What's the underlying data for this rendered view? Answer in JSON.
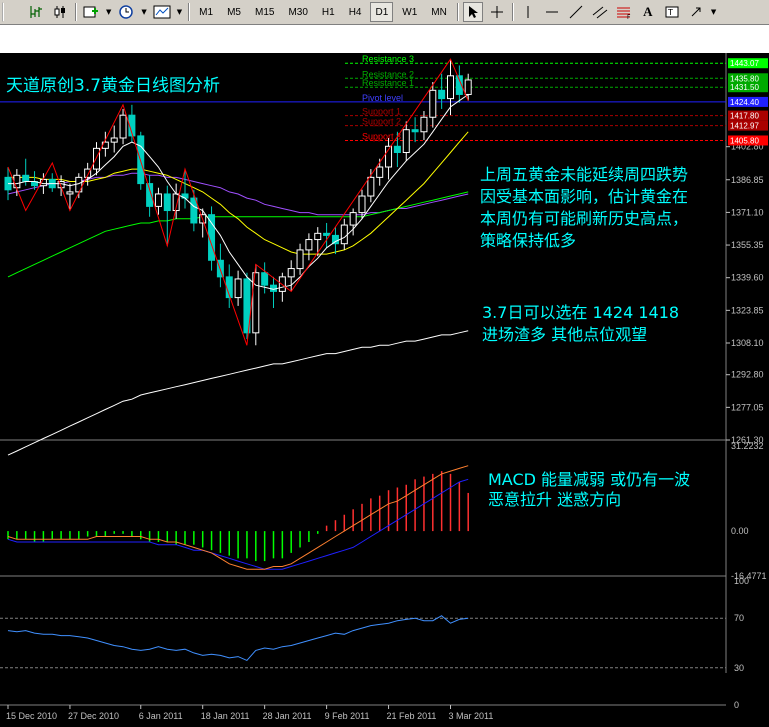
{
  "toolbar": {
    "timeframes": [
      "M1",
      "M5",
      "M15",
      "M30",
      "H1",
      "H4",
      "D1",
      "W1",
      "MN"
    ],
    "active_timeframe": "D1",
    "icons": [
      "chart-bar-icon",
      "chart-candle-icon",
      "chart-line-icon",
      "new-indicator-icon",
      "periods-clock-icon",
      "templates-icon",
      "cursor-icon",
      "crosshair-icon",
      "vertical-line-icon",
      "horizontal-line-icon",
      "trendline-icon",
      "channel-icon",
      "fibo-icon",
      "text-icon",
      "label-icon"
    ]
  },
  "colors": {
    "background": "#000000",
    "bull": "#ffffff",
    "bear": "#00d0c0",
    "ma_fast": "#ffffff",
    "ma_mid": "#ffff00",
    "ma_slow": "#00ff00",
    "ma_200": "#ffffff",
    "ma_purple": "#a050ff",
    "zigzag": "#ff0000",
    "annotation": "#00ffff",
    "grid": "#c0c0c0",
    "macd_pos": "#ff3030",
    "macd_neg": "#00ff00",
    "macd_signal": "#ff8030",
    "macd_main": "#2020ff",
    "rsi": "#4090ff",
    "pivot": "#2020ff",
    "pivot_text": "#4040ff",
    "resistance": "#00ff00",
    "support": "#ff0000"
  },
  "main": {
    "title": "天道原创3.7黄金日线图分析",
    "annotation_1": [
      "上周五黄金未能延续周四跌势",
      "因受基本面影响，估计黄金在",
      "本周仍有可能刷新历史高点，",
      "策略保持低多"
    ],
    "annotation_2": [
      "3.7日可以选在 1424  1418",
      "进场渣多 其他点位观望"
    ],
    "price_ticks": [
      "1402.80",
      "1386.85",
      "1371.10",
      "1355.35",
      "1339.60",
      "1323.85",
      "1308.10",
      "1292.80",
      "1277.05",
      "1261.30"
    ],
    "price_tick_values": [
      1402.8,
      1386.85,
      1371.1,
      1355.35,
      1339.6,
      1323.85,
      1308.1,
      1292.8,
      1277.05,
      1261.3
    ],
    "ylim": [
      1261.3,
      1448
    ],
    "levels": [
      {
        "label": "Resistance 3",
        "price": 1443.07,
        "tag": "1443.07",
        "color": "#00ff00"
      },
      {
        "label": "Resistance 2",
        "price": 1435.8,
        "tag": "1435.80",
        "color": "#00aa00"
      },
      {
        "label": "Resistance 1",
        "price": 1431.5,
        "tag": "1431.50",
        "color": "#00aa00"
      },
      {
        "label": "Pivot level",
        "price": 1424.4,
        "tag": "1424.40",
        "color": "#2020ff"
      },
      {
        "label": "Support 1",
        "price": 1417.8,
        "tag": "1417.80",
        "color": "#aa0000"
      },
      {
        "label": "Support 2",
        "price": 1412.97,
        "tag": "1412.97",
        "color": "#aa0000"
      },
      {
        "label": "Support 3",
        "price": 1405.8,
        "tag": "1405.80",
        "color": "#ff0000"
      }
    ]
  },
  "macd": {
    "annotation": [
      "MACD 能量减弱   或仍有一波",
      "恶意拉升   迷惑方向"
    ],
    "ticks": [
      "31.2232",
      "0.00",
      "-16.4771"
    ],
    "tick_values": [
      31.2232,
      0,
      -16.4771
    ],
    "ylim": [
      -16.4771,
      31.2232
    ]
  },
  "rsi": {
    "ticks": [
      "100",
      "70",
      "30",
      "0"
    ],
    "tick_values": [
      100,
      70,
      30,
      0
    ],
    "ylim": [
      0,
      100
    ]
  },
  "time_axis": [
    "15 Dec 2010",
    "27 Dec 2010",
    "6 Jan 2011",
    "18 Jan 2011",
    "28 Jan 2011",
    "9 Feb 2011",
    "21 Feb 2011",
    "3 Mar 2011"
  ],
  "chart_data": {
    "type": "candlestick",
    "title": "天道原创3.7黄金日线图分析",
    "candles": [
      {
        "o": 1388,
        "h": 1393,
        "l": 1377,
        "c": 1382
      },
      {
        "o": 1383,
        "h": 1392,
        "l": 1379,
        "c": 1389
      },
      {
        "o": 1389,
        "h": 1397,
        "l": 1384,
        "c": 1386
      },
      {
        "o": 1386,
        "h": 1391,
        "l": 1382,
        "c": 1384
      },
      {
        "o": 1384,
        "h": 1390,
        "l": 1380,
        "c": 1387
      },
      {
        "o": 1387,
        "h": 1390,
        "l": 1381,
        "c": 1383
      },
      {
        "o": 1383,
        "h": 1389,
        "l": 1379,
        "c": 1386
      },
      {
        "o": 1380,
        "h": 1385,
        "l": 1372,
        "c": 1381
      },
      {
        "o": 1381,
        "h": 1390,
        "l": 1378,
        "c": 1388
      },
      {
        "o": 1388,
        "h": 1395,
        "l": 1384,
        "c": 1392
      },
      {
        "o": 1392,
        "h": 1405,
        "l": 1389,
        "c": 1402
      },
      {
        "o": 1402,
        "h": 1410,
        "l": 1398,
        "c": 1405
      },
      {
        "o": 1405,
        "h": 1413,
        "l": 1400,
        "c": 1407
      },
      {
        "o": 1407,
        "h": 1421,
        "l": 1404,
        "c": 1418
      },
      {
        "o": 1418,
        "h": 1423,
        "l": 1405,
        "c": 1408
      },
      {
        "o": 1408,
        "h": 1410,
        "l": 1382,
        "c": 1385
      },
      {
        "o": 1385,
        "h": 1389,
        "l": 1369,
        "c": 1374
      },
      {
        "o": 1374,
        "h": 1383,
        "l": 1370,
        "c": 1380
      },
      {
        "o": 1380,
        "h": 1384,
        "l": 1355,
        "c": 1372
      },
      {
        "o": 1372,
        "h": 1385,
        "l": 1368,
        "c": 1380
      },
      {
        "o": 1380,
        "h": 1392,
        "l": 1373,
        "c": 1378
      },
      {
        "o": 1378,
        "h": 1382,
        "l": 1362,
        "c": 1366
      },
      {
        "o": 1366,
        "h": 1373,
        "l": 1359,
        "c": 1370
      },
      {
        "o": 1370,
        "h": 1374,
        "l": 1343,
        "c": 1348
      },
      {
        "o": 1348,
        "h": 1356,
        "l": 1335,
        "c": 1340
      },
      {
        "o": 1340,
        "h": 1346,
        "l": 1325,
        "c": 1330
      },
      {
        "o": 1330,
        "h": 1343,
        "l": 1326,
        "c": 1339
      },
      {
        "o": 1339,
        "h": 1342,
        "l": 1310,
        "c": 1313
      },
      {
        "o": 1313,
        "h": 1346,
        "l": 1307,
        "c": 1342
      },
      {
        "o": 1342,
        "h": 1347,
        "l": 1332,
        "c": 1336
      },
      {
        "o": 1336,
        "h": 1340,
        "l": 1325,
        "c": 1333
      },
      {
        "o": 1333,
        "h": 1342,
        "l": 1328,
        "c": 1340
      },
      {
        "o": 1340,
        "h": 1348,
        "l": 1333,
        "c": 1344
      },
      {
        "o": 1344,
        "h": 1356,
        "l": 1341,
        "c": 1353
      },
      {
        "o": 1353,
        "h": 1361,
        "l": 1348,
        "c": 1358
      },
      {
        "o": 1358,
        "h": 1364,
        "l": 1350,
        "c": 1361
      },
      {
        "o": 1361,
        "h": 1366,
        "l": 1354,
        "c": 1360
      },
      {
        "o": 1360,
        "h": 1364,
        "l": 1351,
        "c": 1356
      },
      {
        "o": 1356,
        "h": 1368,
        "l": 1353,
        "c": 1365
      },
      {
        "o": 1365,
        "h": 1373,
        "l": 1360,
        "c": 1371
      },
      {
        "o": 1371,
        "h": 1382,
        "l": 1368,
        "c": 1379
      },
      {
        "o": 1379,
        "h": 1392,
        "l": 1376,
        "c": 1388
      },
      {
        "o": 1388,
        "h": 1397,
        "l": 1384,
        "c": 1393
      },
      {
        "o": 1393,
        "h": 1407,
        "l": 1387,
        "c": 1403
      },
      {
        "o": 1403,
        "h": 1410,
        "l": 1393,
        "c": 1400
      },
      {
        "o": 1400,
        "h": 1415,
        "l": 1396,
        "c": 1411
      },
      {
        "o": 1411,
        "h": 1417,
        "l": 1405,
        "c": 1410
      },
      {
        "o": 1410,
        "h": 1420,
        "l": 1406,
        "c": 1417
      },
      {
        "o": 1417,
        "h": 1434,
        "l": 1412,
        "c": 1430
      },
      {
        "o": 1430,
        "h": 1438,
        "l": 1421,
        "c": 1426
      },
      {
        "o": 1426,
        "h": 1445,
        "l": 1418,
        "c": 1437
      },
      {
        "o": 1437,
        "h": 1442,
        "l": 1424,
        "c": 1428
      },
      {
        "o": 1428,
        "h": 1438,
        "l": 1425,
        "c": 1435
      }
    ],
    "ma_fast": [
      1385,
      1385,
      1386,
      1386,
      1385,
      1385,
      1385,
      1384,
      1385,
      1387,
      1390,
      1394,
      1398,
      1403,
      1405,
      1403,
      1398,
      1393,
      1386,
      1380,
      1378,
      1374,
      1372,
      1366,
      1360,
      1352,
      1346,
      1340,
      1336,
      1335,
      1334,
      1335,
      1336,
      1340,
      1345,
      1349,
      1354,
      1357,
      1359,
      1363,
      1368,
      1374,
      1380,
      1386,
      1391,
      1396,
      1400,
      1404,
      1410,
      1416,
      1422,
      1425,
      1428
    ],
    "ma_mid": [
      1388,
      1388,
      1388,
      1388,
      1387,
      1387,
      1387,
      1386,
      1386,
      1386,
      1387,
      1388,
      1390,
      1391,
      1392,
      1392,
      1391,
      1390,
      1389,
      1387,
      1385,
      1383,
      1381,
      1378,
      1375,
      1371,
      1368,
      1364,
      1361,
      1358,
      1356,
      1354,
      1352,
      1351,
      1351,
      1351,
      1351,
      1352,
      1353,
      1355,
      1358,
      1361,
      1365,
      1369,
      1373,
      1377,
      1381,
      1385,
      1390,
      1395,
      1400,
      1405,
      1410
    ],
    "ma_slow": [
      1340,
      1342,
      1344,
      1346,
      1348,
      1350,
      1352,
      1354,
      1356,
      1358,
      1360,
      1362,
      1363,
      1364,
      1365,
      1366,
      1366,
      1367,
      1367,
      1368,
      1368,
      1368,
      1369,
      1369,
      1369,
      1369,
      1369,
      1369,
      1369,
      1369,
      1369,
      1369,
      1369,
      1369,
      1369,
      1369,
      1369,
      1369,
      1369,
      1369,
      1369,
      1370,
      1371,
      1372,
      1373,
      1374,
      1375,
      1376,
      1377,
      1378,
      1379,
      1380,
      1381
    ],
    "ma_200": [
      1254,
      1256,
      1258,
      1260,
      1262,
      1264,
      1266,
      1268,
      1270,
      1272,
      1274,
      1276,
      1278,
      1280,
      1281,
      1283,
      1284,
      1285,
      1286,
      1287,
      1288,
      1289,
      1290,
      1291,
      1292,
      1293,
      1294,
      1295,
      1296,
      1297,
      1298,
      1298,
      1299,
      1300,
      1301,
      1302,
      1303,
      1303,
      1304,
      1305,
      1306,
      1306,
      1307,
      1307,
      1308,
      1309,
      1309,
      1310,
      1311,
      1312,
      1312,
      1313,
      1314
    ],
    "ma_purple": [
      1380,
      1381,
      1382,
      1383,
      1384,
      1385,
      1385,
      1386,
      1386,
      1387,
      1388,
      1388,
      1389,
      1389,
      1390,
      1390,
      1389,
      1389,
      1388,
      1388,
      1387,
      1386,
      1385,
      1384,
      1383,
      1381,
      1380,
      1378,
      1377,
      1375,
      1374,
      1373,
      1372,
      1371,
      1371,
      1370,
      1370,
      1370,
      1370,
      1370,
      1370,
      1371,
      1371,
      1372,
      1373,
      1373,
      1374,
      1375,
      1376,
      1377,
      1378,
      1379,
      1380
    ],
    "zigzag": [
      [
        0,
        1393
      ],
      [
        2,
        1372
      ],
      [
        5,
        1395
      ],
      [
        7,
        1372
      ],
      [
        13,
        1423
      ],
      [
        18,
        1355
      ],
      [
        20,
        1392
      ],
      [
        27,
        1307
      ],
      [
        28,
        1346
      ],
      [
        32,
        1333
      ],
      [
        50,
        1445
      ],
      [
        52,
        1425
      ]
    ],
    "macd_hist": [
      -3,
      -3,
      -3,
      -4,
      -4,
      -3,
      -3,
      -3,
      -3,
      -2,
      -2,
      -2,
      -1,
      -1,
      -2,
      -3,
      -4,
      -4,
      -4,
      -5,
      -5,
      -5,
      -6,
      -7,
      -8,
      -9,
      -10,
      -10,
      -11,
      -11,
      -10,
      -10,
      -8,
      -6,
      -4,
      -1,
      2,
      4,
      6,
      8,
      10,
      12,
      13,
      15,
      16,
      17,
      19,
      20,
      21,
      22,
      21,
      18,
      14
    ],
    "macd_signal": [
      -2,
      -3,
      -3,
      -3,
      -3,
      -3,
      -3,
      -3,
      -3,
      -3,
      -2,
      -2,
      -2,
      -2,
      -2,
      -2,
      -3,
      -3,
      -4,
      -4,
      -5,
      -6,
      -7,
      -8,
      -10,
      -12,
      -13,
      -14,
      -14,
      -14,
      -13,
      -13,
      -12,
      -10,
      -8,
      -6,
      -4,
      -2,
      0,
      2,
      4,
      6,
      8,
      10,
      11,
      13,
      15,
      17,
      19,
      21,
      22,
      23,
      24
    ],
    "macd_main": [
      -3,
      -4,
      -4,
      -4,
      -4,
      -4,
      -4,
      -4,
      -4,
      -4,
      -4,
      -4,
      -4,
      -4,
      -4,
      -4,
      -4,
      -5,
      -5,
      -5,
      -6,
      -7,
      -7,
      -8,
      -9,
      -10,
      -11,
      -12,
      -13,
      -14,
      -14,
      -14,
      -13,
      -12,
      -11,
      -10,
      -9,
      -8,
      -7,
      -6,
      -4,
      -2,
      0,
      2,
      4,
      6,
      8,
      10,
      12,
      14,
      16,
      18,
      19
    ],
    "rsi": [
      60,
      59,
      60,
      58,
      57,
      57,
      56,
      56,
      55,
      54,
      52,
      50,
      48,
      47,
      45,
      44,
      45,
      47,
      45,
      44,
      45,
      42,
      40,
      41,
      40,
      38,
      39,
      36,
      44,
      46,
      45,
      47,
      48,
      50,
      52,
      54,
      56,
      58,
      57,
      60,
      62,
      64,
      65,
      66,
      68,
      69,
      70,
      68,
      68,
      72,
      66,
      69,
      70
    ],
    "x_labels": [
      "15 Dec 2010",
      "27 Dec 2010",
      "6 Jan 2011",
      "18 Jan 2011",
      "28 Jan 2011",
      "9 Feb 2011",
      "21 Feb 2011",
      "3 Mar 2011"
    ],
    "indicators": [
      "MACD",
      "RSI"
    ]
  }
}
